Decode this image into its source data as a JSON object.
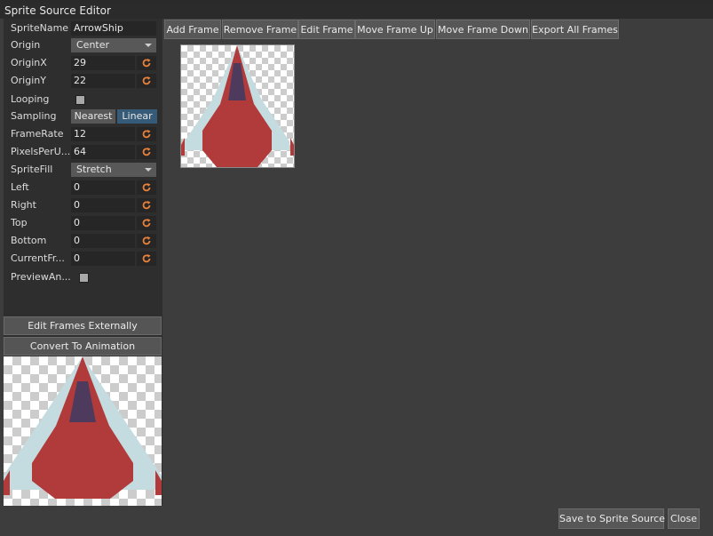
{
  "window": {
    "title": "Sprite Source Editor"
  },
  "properties": {
    "sprite_name": {
      "label": "SpriteName",
      "value": "ArrowShip"
    },
    "origin": {
      "label": "Origin",
      "value": "Center"
    },
    "origin_x": {
      "label": "OriginX",
      "value": "29"
    },
    "origin_y": {
      "label": "OriginY",
      "value": "22"
    },
    "looping": {
      "label": "Looping",
      "checked": false
    },
    "sampling": {
      "label": "Sampling",
      "options": [
        "Nearest",
        "Linear"
      ],
      "selected": "Linear"
    },
    "frame_rate": {
      "label": "FrameRate",
      "value": "12"
    },
    "pixels_per_unit": {
      "label": "PixelsPerU...",
      "value": "64"
    },
    "sprite_fill": {
      "label": "SpriteFill",
      "value": "Stretch"
    },
    "left": {
      "label": "Left",
      "value": "0"
    },
    "right": {
      "label": "Right",
      "value": "0"
    },
    "top": {
      "label": "Top",
      "value": "0"
    },
    "bottom": {
      "label": "Bottom",
      "value": "0"
    },
    "current_frame": {
      "label": "CurrentFr...",
      "value": "0"
    },
    "preview_animation": {
      "label": "PreviewAn...",
      "checked": false
    }
  },
  "actions": {
    "edit_frames_externally": "Edit Frames Externally",
    "convert_to_animation": "Convert To Animation"
  },
  "toolbar": {
    "add_frame": "Add Frame",
    "remove_frame": "Remove Frame",
    "edit_frame": "Edit Frame",
    "move_frame_up": "Move Frame Up",
    "move_frame_down": "Move Frame Down",
    "export_all_frames": "Export All Frames"
  },
  "footer": {
    "save": "Save to Sprite Source",
    "close": "Close"
  },
  "icons": {
    "reset": "reset-icon",
    "dropdown": "chevron-down-icon"
  },
  "colors": {
    "accent_selected": "#355b78",
    "reset_icon": "#e8803a",
    "ship_body": "#b13a3a",
    "ship_wing": "#c4dce0",
    "ship_cockpit": "#4d3a5c"
  }
}
